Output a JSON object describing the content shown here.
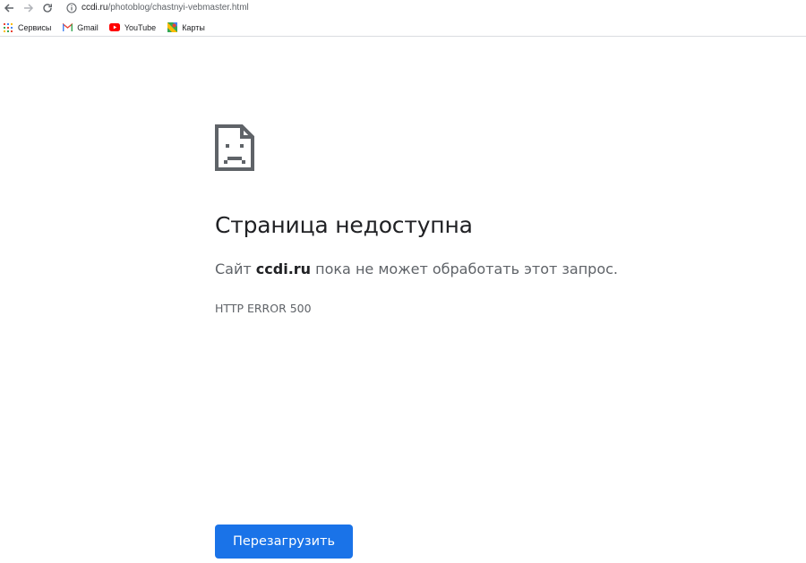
{
  "browser": {
    "url_host": "ccdi.ru",
    "url_path": "/photoblog/chastnyi-vebmaster.html",
    "bookmarks": [
      {
        "label": "Сервисы",
        "icon": "apps-grid-icon"
      },
      {
        "label": "Gmail",
        "icon": "gmail-icon"
      },
      {
        "label": "YouTube",
        "icon": "youtube-icon"
      },
      {
        "label": "Карты",
        "icon": "maps-icon"
      }
    ]
  },
  "error_page": {
    "icon": "sad-document-icon",
    "title": "Страница недоступна",
    "desc_prefix": "Сайт ",
    "desc_host": "ccdi.ru",
    "desc_suffix": " пока не может обработать этот запрос.",
    "code": "HTTP ERROR 500",
    "reload_label": "Перезагрузить"
  },
  "colors": {
    "button": "#1a73e8",
    "title": "#202124",
    "secondary_text": "#5f6368",
    "icon": "#5f6368"
  }
}
